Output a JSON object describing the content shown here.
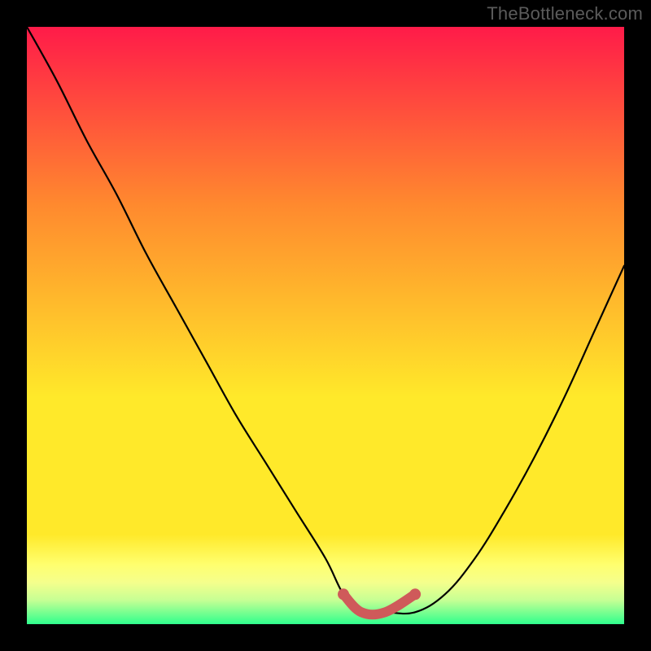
{
  "watermark": "TheBottleneck.com",
  "colors": {
    "gradient_top": "#ff1b49",
    "gradient_mid1": "#ff8a2e",
    "gradient_mid2": "#ffe92a",
    "gradient_bottom_band1": "#ffff6e",
    "gradient_bottom_band2": "#f5ff8c",
    "gradient_bottom_band3": "#c6ff94",
    "gradient_bottom_band4": "#2fff8d",
    "curve": "#000000",
    "marker": "#cf5a5a",
    "frame": "#000000"
  },
  "chart_data": {
    "type": "line",
    "title": "",
    "xlabel": "",
    "ylabel": "",
    "xlim": [
      0,
      100
    ],
    "ylim": [
      0,
      100
    ],
    "grid": false,
    "legend": false,
    "series": [
      {
        "name": "bottleneck-curve",
        "x": [
          0,
          5,
          10,
          15,
          20,
          25,
          30,
          35,
          40,
          45,
          50,
          53,
          56,
          60,
          65,
          70,
          75,
          80,
          85,
          90,
          95,
          100
        ],
        "y": [
          100,
          91,
          81,
          72,
          62,
          53,
          44,
          35,
          27,
          19,
          11,
          5,
          2,
          2,
          2,
          5,
          11,
          19,
          28,
          38,
          49,
          60
        ]
      },
      {
        "name": "optimal-band-marker",
        "x": [
          53,
          56,
          60,
          65
        ],
        "y": [
          5,
          2,
          2,
          5
        ]
      }
    ],
    "annotations": []
  }
}
